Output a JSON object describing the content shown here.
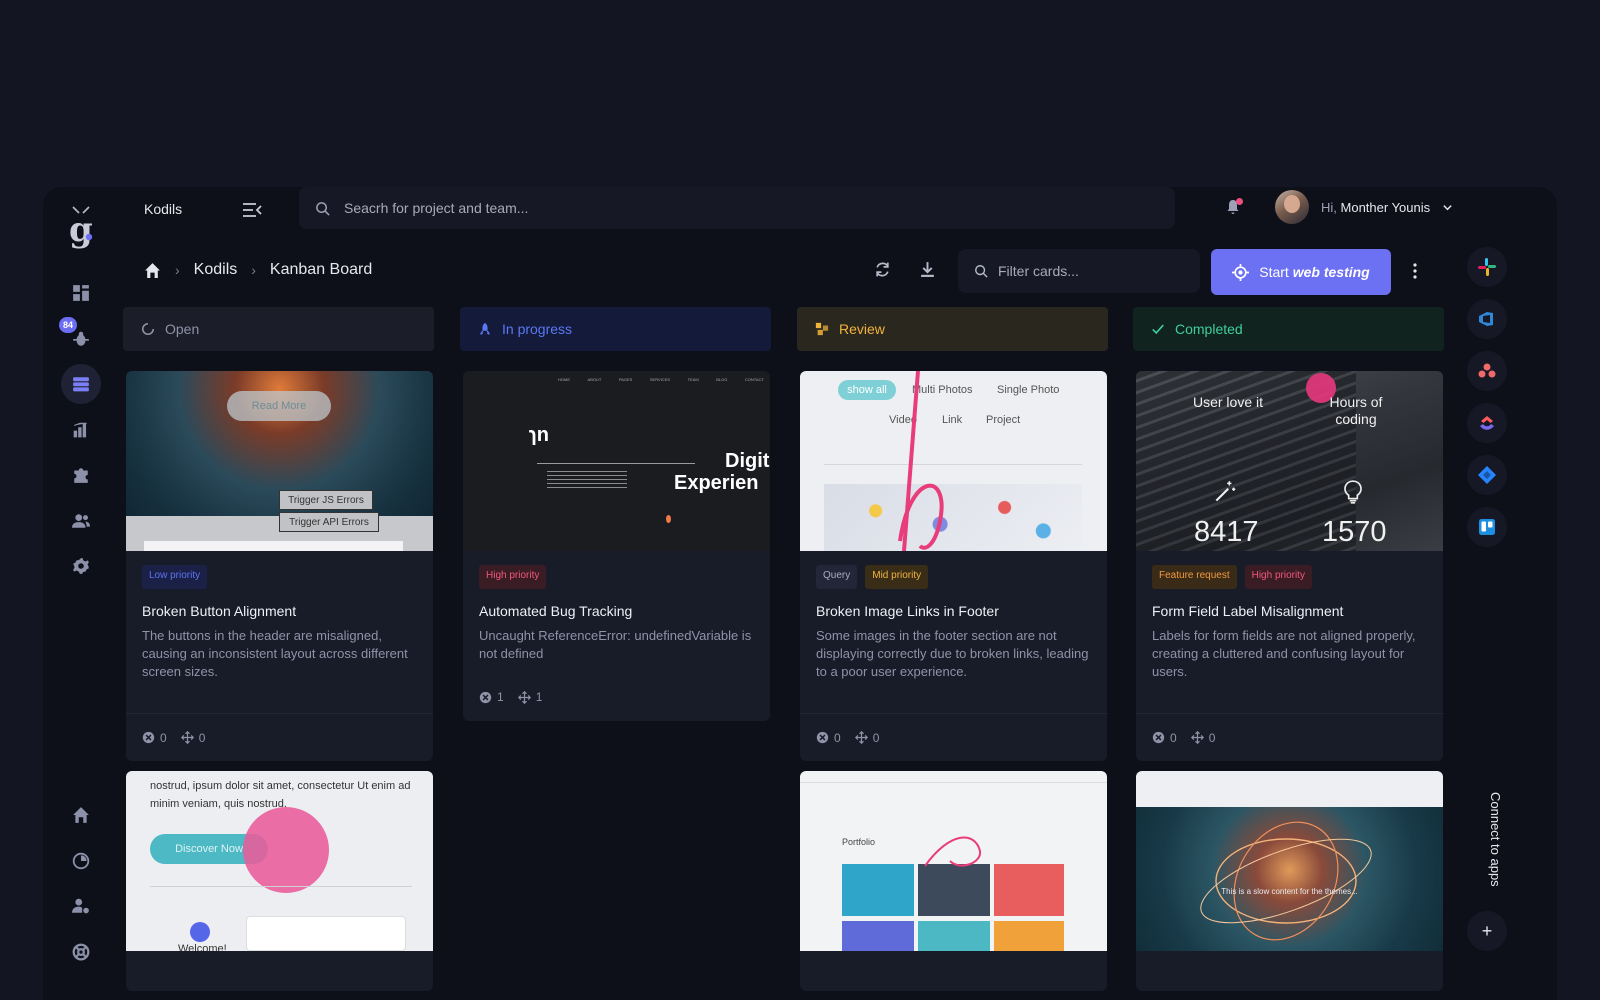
{
  "app": {
    "name": "Kodils",
    "logo_letter": "g"
  },
  "rail": {
    "bugs_badge": "84"
  },
  "search": {
    "placeholder": "Seacrh for project and team..."
  },
  "user": {
    "greeting": "Hi,",
    "name": "Monther Younis"
  },
  "breadcrumb": {
    "root": "Kodils",
    "current": "Kanban Board"
  },
  "filter": {
    "placeholder": "Filter cards..."
  },
  "start_button": {
    "prefix": "Start",
    "emphasis": "web testing"
  },
  "columns": [
    {
      "label": "Open",
      "color": "#8f92a6"
    },
    {
      "label": "In progress",
      "color": "#5b78f5"
    },
    {
      "label": "Review",
      "color": "#f2b33d"
    },
    {
      "label": "Completed",
      "color": "#3fcf9a"
    }
  ],
  "cards": [
    {
      "tags": [
        "Low priority"
      ],
      "title": "Broken Button Alignment",
      "description": "The buttons in the header are misaligned, causing an inconsistent layout across different screen sizes.",
      "errors": "0",
      "links": "0",
      "thumb": {
        "button": "Read More",
        "trigger1": "Trigger JS Errors",
        "trigger2": "Trigger API Errors"
      }
    },
    {
      "tags": [
        "High priority"
      ],
      "title": "Automated Bug Tracking",
      "description": "Uncaught ReferenceError: undefinedVariable is not defined",
      "errors": "1",
      "links": "1",
      "thumb": {
        "nav": [
          "HOME",
          "ABOUT",
          "PAGES",
          "SERVICES",
          "TEAM",
          "BLOG",
          "CONTACT"
        ],
        "brand": "ɿn",
        "heading1": "Digit",
        "heading2": "Experien"
      }
    },
    {
      "tags": [
        "Query",
        "Mid priority"
      ],
      "title": "Broken Image Links in Footer",
      "description": "Some images in the footer section are not displaying correctly due to broken links, leading to a poor user experience.",
      "errors": "0",
      "links": "0",
      "thumb": {
        "chips": [
          "show all",
          "Multi Photos",
          "Single Photo",
          "Video",
          "Link",
          "Project"
        ]
      }
    },
    {
      "tags": [
        "Feature request",
        "High priority"
      ],
      "title": "Form Field Label Misalignment",
      "description": "Labels for form fields are not aligned properly, creating a cluttered and confusing layout for users.",
      "errors": "0",
      "links": "0",
      "thumb": {
        "stat1_label": "User love it",
        "stat1_value": "8417",
        "stat2_label": "Hours of coding",
        "stat2_value": "1570"
      }
    }
  ],
  "lower_cards": {
    "discover": {
      "text": "nostrud, ipsum dolor sit amet, consectetur Ut enim ad minim veniam, quis nostrud.",
      "button": "Discover Now",
      "welcome": "Welcome!"
    },
    "portfolio": {
      "title": "Portfolio"
    },
    "burst": {
      "caption": "This is a slow content for the themes..."
    }
  },
  "integrations": {
    "connect_label": "Connect to apps",
    "apps": [
      "slack-icon",
      "azure-devops-icon",
      "asana-icon",
      "clickup-icon",
      "jira-icon",
      "trello-icon"
    ]
  }
}
